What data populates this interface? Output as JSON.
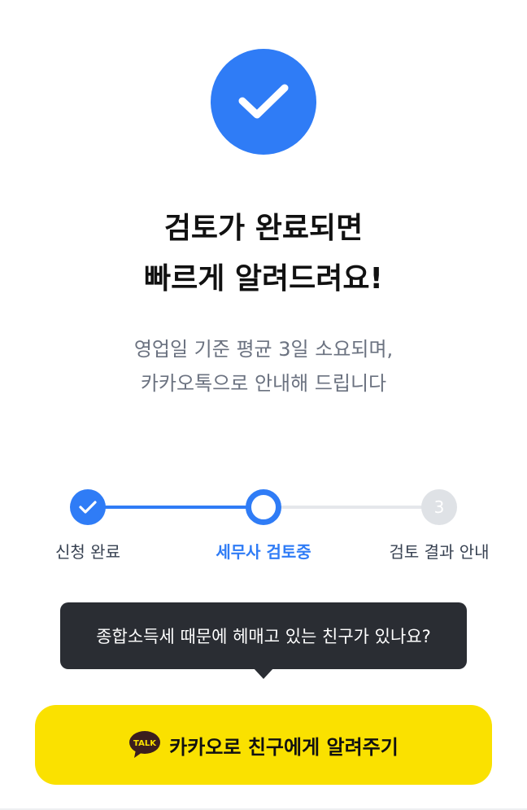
{
  "headline": {
    "line1": "검토가 완료되면",
    "line2": "빠르게 알려드려요!"
  },
  "subtext": {
    "line1": "영업일 기준 평균 3일 소요되며,",
    "line2": "카카오톡으로 안내해 드립니다"
  },
  "steps": [
    {
      "label": "신청 완료",
      "state": "done"
    },
    {
      "label": "세무사 검토중",
      "state": "current"
    },
    {
      "label": "검토 결과 안내",
      "state": "pending",
      "number": "3"
    }
  ],
  "tooltip": {
    "text": "종합소득세 때문에 헤매고 있는 친구가 있나요?"
  },
  "kakao_button": {
    "icon_text": "TALK",
    "label": "카카오로 친구에게 알려주기"
  },
  "colors": {
    "primary": "#2f7cf6",
    "kakao_yellow": "#fae100",
    "tooltip_bg": "#2a2d33",
    "pending_gray": "#dfe2e6"
  }
}
